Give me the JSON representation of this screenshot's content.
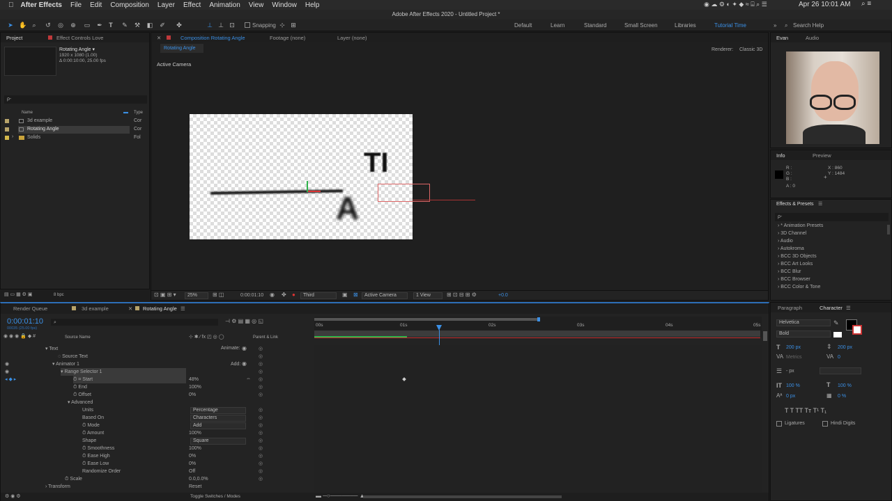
{
  "menubar": {
    "app": "After Effects",
    "items": [
      "File",
      "Edit",
      "Composition",
      "Layer",
      "Effect",
      "Animation",
      "View",
      "Window",
      "Help"
    ],
    "clock": "Apr 26  10:01 AM"
  },
  "titlebar": {
    "title": "Adobe After Effects 2020 - Untitled Project *"
  },
  "toolbar": {
    "snapping": "Snapping",
    "workspaces": [
      "Default",
      "Learn",
      "Standard",
      "Small Screen",
      "Libraries",
      "Tutorial Time"
    ],
    "search": "Search Help"
  },
  "project": {
    "tab": "Project",
    "tab2": "Effect Controls Love",
    "comp_name": "Rotating Angle ▾",
    "comp_size": "1920 x 1080 (1.00)",
    "comp_dur": "Δ 0:00:10:00, 25.00 fps",
    "search": "ρ-",
    "col_name": "Name",
    "col_type": "Type",
    "items": [
      {
        "name": "3d example",
        "type": "Cor"
      },
      {
        "name": "Rotating Angle",
        "type": "Cor"
      },
      {
        "name": "Solids",
        "type": "Fol"
      }
    ],
    "bpc": "8 bpc"
  },
  "comp": {
    "tab": "Composition Rotating Angle",
    "footage": "Footage (none)",
    "layer": "Layer (none)",
    "subtab": "Rotating Angle",
    "renderer_label": "Renderer:",
    "renderer": "Classic 3D",
    "camera_label": "Active Camera",
    "zoom": "25%",
    "timecode": "0:00:01:10",
    "res": "Third",
    "camera": "Active Camera",
    "views": "1 View",
    "exposure": "+0.0"
  },
  "right": {
    "evan": "Evan",
    "audio": "Audio",
    "info": "Info",
    "preview": "Preview",
    "info_r": "R :",
    "info_g": "G :",
    "info_b": "B :",
    "info_a": "A :  0",
    "info_x": "X :  860",
    "info_y": "Y :  1484",
    "effects_title": "Effects & Presets",
    "effects_search": "ρ-",
    "effects": [
      "* Animation Presets",
      "3D Channel",
      "Audio",
      "Autokroma",
      "BCC 3D Objects",
      "BCC Art Looks",
      "BCC Blur",
      "BCC Browser",
      "BCC Color & Tone"
    ]
  },
  "char": {
    "paragraph": "Paragraph",
    "character": "Character",
    "font": "Helvetica",
    "style": "Bold",
    "size": "200 px",
    "leading": "200 px",
    "kerning": "Metrics",
    "tracking": "0",
    "stroke": "- px",
    "vscale": "100 %",
    "hscale": "100 %",
    "baseline": "0 px",
    "tsume": "0 %",
    "ligatures": "Ligatures",
    "hindi": "Hindi Digits"
  },
  "timeline": {
    "tabs": [
      "Render Queue",
      "3d example",
      "Rotating Angle"
    ],
    "timecode": "0:00:01:10",
    "fps": "00035 (25.00 fps)",
    "col_source": "Source Name",
    "col_parent": "Parent & Link",
    "ruler": [
      "00s",
      "01s",
      "02s",
      "03s",
      "04s",
      "05s"
    ],
    "toggle": "Toggle Switches / Modes",
    "rows": [
      {
        "label": "Text",
        "value": "",
        "extra": "Animate:"
      },
      {
        "label": "Source Text",
        "value": "",
        "extra": ""
      },
      {
        "label": "Animator 1",
        "value": "",
        "extra": "Add:"
      },
      {
        "label": "Range Selector 1",
        "value": "",
        "extra": ""
      },
      {
        "label": "Start",
        "value": "48%",
        "extra": ""
      },
      {
        "label": "End",
        "value": "100%",
        "extra": ""
      },
      {
        "label": "Offset",
        "value": "0%",
        "extra": ""
      },
      {
        "label": "Advanced",
        "value": "",
        "extra": ""
      },
      {
        "label": "Units",
        "value": "Percentage",
        "extra": ""
      },
      {
        "label": "Based On",
        "value": "Characters",
        "extra": ""
      },
      {
        "label": "Mode",
        "value": "Add",
        "extra": ""
      },
      {
        "label": "Amount",
        "value": "100%",
        "extra": ""
      },
      {
        "label": "Shape",
        "value": "Square",
        "extra": ""
      },
      {
        "label": "Smoothness",
        "value": "100%",
        "extra": ""
      },
      {
        "label": "Ease High",
        "value": "0%",
        "extra": ""
      },
      {
        "label": "Ease Low",
        "value": "0%",
        "extra": ""
      },
      {
        "label": "Randomize Order",
        "value": "Off",
        "extra": ""
      },
      {
        "label": "Scale",
        "value": "0.0,0.0%",
        "extra": ""
      },
      {
        "label": "Transform",
        "value": "Reset",
        "extra": ""
      }
    ]
  }
}
